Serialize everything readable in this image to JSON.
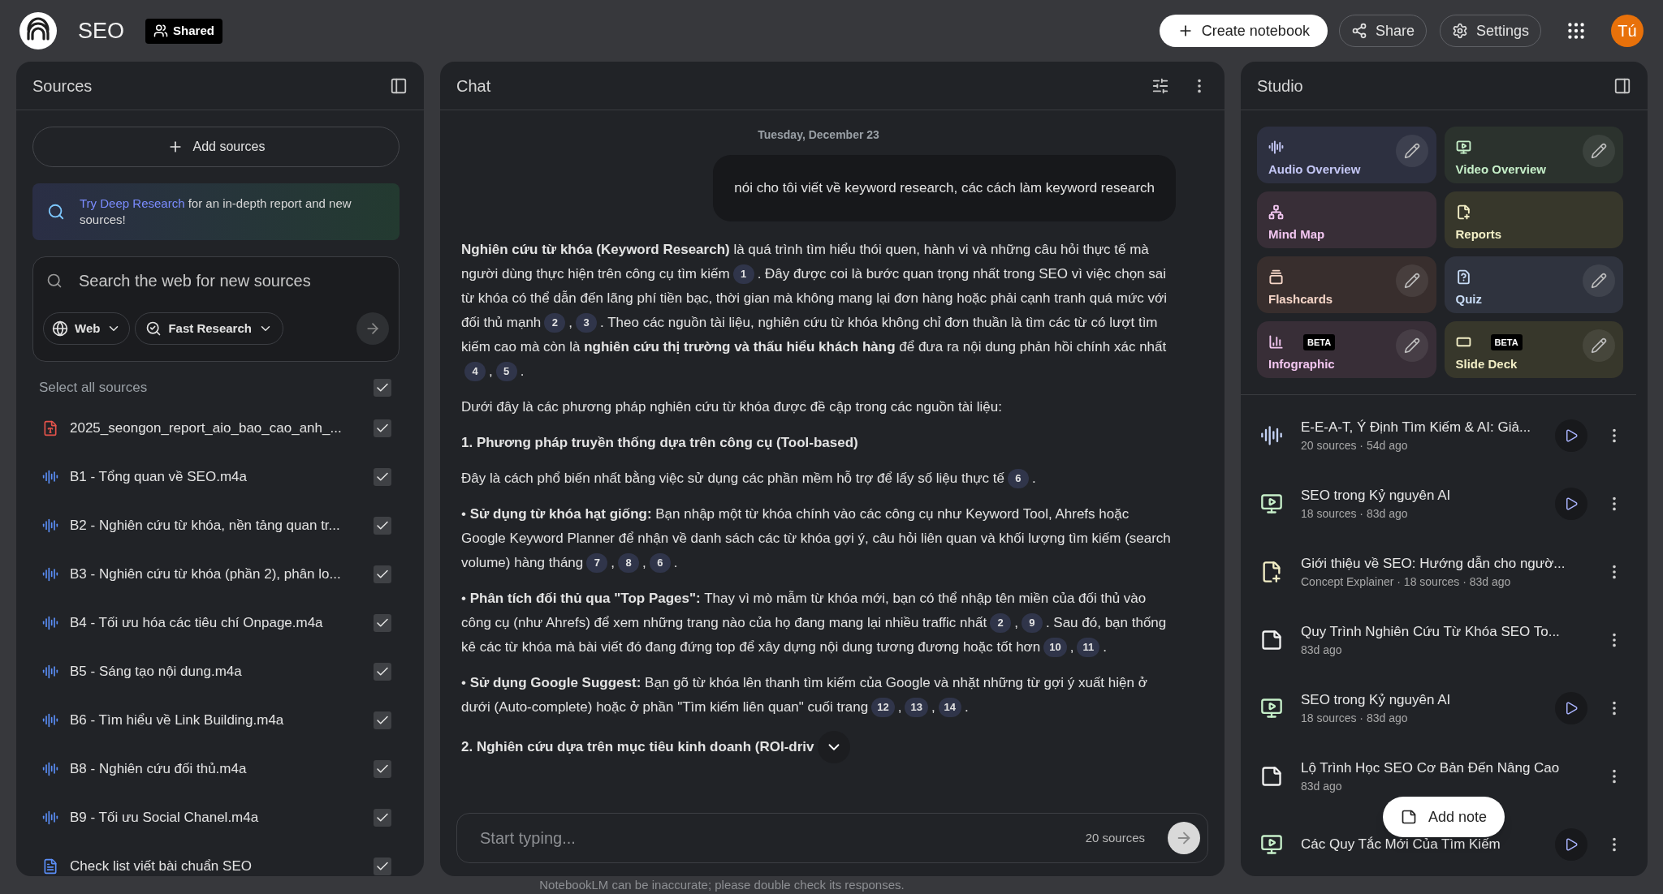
{
  "top_bar": {
    "notebook_title": "SEO",
    "shared_badge": "Shared",
    "create_button": "Create notebook",
    "share_button": "Share",
    "settings_button": "Settings",
    "avatar": "Tú"
  },
  "sources": {
    "title": "Sources",
    "add_button": "Add sources",
    "deep_research": {
      "link": "Try Deep Research",
      "text": "for an in-depth report and new sources!"
    },
    "search": {
      "placeholder": "Search the web for new sources"
    },
    "web_dropdown": "Web",
    "mode_dropdown": "Fast Research",
    "select_all": {
      "label": "Select all sources",
      "checked": true
    },
    "items": [
      {
        "kind": "pdf",
        "name": "2025_seongon_report_aio_bao_cao_anh_...",
        "checked": true
      },
      {
        "kind": "audio",
        "name": "B1 - Tổng quan về SEO.m4a",
        "checked": true
      },
      {
        "kind": "audio",
        "name": "B2 - Nghiên cứu từ khóa, nền tảng quan tr...",
        "checked": true
      },
      {
        "kind": "audio",
        "name": "B3 - Nghiên cứu từ khóa (phần 2), phân lo...",
        "checked": true
      },
      {
        "kind": "audio",
        "name": "B4 - Tối ưu hóa các tiêu chí Onpage.m4a",
        "checked": true
      },
      {
        "kind": "audio",
        "name": "B5 - Sáng tạo nội dung.m4a",
        "checked": true
      },
      {
        "kind": "audio",
        "name": "B6 - Tìm hiểu về Link Building.m4a",
        "checked": true
      },
      {
        "kind": "audio",
        "name": "B8 - Nghiên cứu đối thủ.m4a",
        "checked": true
      },
      {
        "kind": "audio",
        "name": "B9 - Tối ưu Social Chanel.m4a",
        "checked": true
      },
      {
        "kind": "doc",
        "name": "Check list viết bài chuẩn SEO",
        "checked": true
      }
    ]
  },
  "chat": {
    "title": "Chat",
    "date": "Tuesday, December 23",
    "user_message": "nói cho tôi viết về keyword research, các cách làm keyword research",
    "blocks": [
      {
        "kind": "paragraph",
        "segments": [
          {
            "kind": "text",
            "text": "**Nghiên cứu từ khóa (Keyword Research)** là quá trình tìm hiểu thói quen, hành vi và những câu hỏi thực tế mà người dùng thực hiện trên công cụ tìm kiếm"
          },
          {
            "kind": "cite",
            "text": "1"
          },
          {
            "kind": "text",
            "text": ". Đây được coi là bước quan trọng nhất trong SEO vì việc chọn sai từ khóa có thể dẫn đến lãng phí tiền bạc, thời gian mà không mang lại đơn hàng hoặc phải cạnh tranh quá mức với đối thủ mạnh"
          },
          {
            "kind": "cite",
            "text": "2"
          },
          {
            "kind": "text",
            "text": ","
          },
          {
            "kind": "cite",
            "text": "3"
          },
          {
            "kind": "text",
            "text": ". Theo các nguồn tài liệu, nghiên cứu từ khóa không chỉ đơn thuần là tìm các từ có lượt tìm kiếm cao mà còn là **nghiên cứu thị trường và thấu hiểu khách hàng** để đưa ra nội dung phản hồi chính xác nhất"
          },
          {
            "kind": "cite",
            "text": "4"
          },
          {
            "kind": "text",
            "text": ","
          },
          {
            "kind": "cite",
            "text": "5"
          },
          {
            "kind": "text",
            "text": "."
          }
        ]
      },
      {
        "kind": "paragraph",
        "segments": [
          {
            "kind": "text",
            "text": "Dưới đây là các phương pháp nghiên cứu từ khóa được đề cập trong các nguồn tài liệu:"
          }
        ]
      },
      {
        "kind": "heading",
        "segments": [
          {
            "kind": "text",
            "text": "1. Phương pháp truyền thống dựa trên công cụ (Tool-based)"
          }
        ]
      },
      {
        "kind": "paragraph",
        "segments": [
          {
            "kind": "text",
            "text": "Đây là cách phổ biến nhất bằng việc sử dụng các phần mềm hỗ trợ để lấy số liệu thực tế"
          },
          {
            "kind": "cite",
            "text": "6"
          },
          {
            "kind": "text",
            "text": "."
          }
        ]
      },
      {
        "kind": "paragraph",
        "segments": [
          {
            "kind": "text",
            "text": "• **Sử dụng từ khóa hạt giống:** Bạn nhập một từ khóa chính vào các công cụ như Keyword Tool, Ahrefs hoặc Google Keyword Planner để nhận về danh sách các từ khóa gợi ý, câu hỏi liên quan và khối lượng tìm kiếm (search volume) hàng tháng"
          },
          {
            "kind": "cite",
            "text": "7"
          },
          {
            "kind": "text",
            "text": ","
          },
          {
            "kind": "cite",
            "text": "8"
          },
          {
            "kind": "text",
            "text": ","
          },
          {
            "kind": "cite",
            "text": "6"
          },
          {
            "kind": "text",
            "text": "."
          }
        ]
      },
      {
        "kind": "paragraph",
        "segments": [
          {
            "kind": "text",
            "text": "• **Phân tích đối thủ qua \"Top Pages\":** Thay vì mò mẫm từ khóa mới, bạn có thể nhập tên miền của đối thủ vào công cụ (như Ahrefs) để xem những trang nào của họ đang mang lại nhiều traffic nhất"
          },
          {
            "kind": "cite",
            "text": "2"
          },
          {
            "kind": "text",
            "text": ","
          },
          {
            "kind": "cite",
            "text": "9"
          },
          {
            "kind": "text",
            "text": ". Sau đó, bạn thống kê các từ khóa mà bài viết đó đang đứng top để xây dựng nội dung tương đương hoặc tốt hơn"
          },
          {
            "kind": "cite",
            "text": "10"
          },
          {
            "kind": "text",
            "text": ","
          },
          {
            "kind": "cite",
            "text": "11"
          },
          {
            "kind": "text",
            "text": "."
          }
        ]
      },
      {
        "kind": "paragraph",
        "segments": [
          {
            "kind": "text",
            "text": "• **Sử dụng Google Suggest:** Bạn gõ từ khóa lên thanh tìm kiếm của Google và nhặt những từ gợi ý xuất hiện ở dưới (Auto-complete) hoặc ở phần \"Tìm kiếm liên quan\" cuối trang"
          },
          {
            "kind": "cite",
            "text": "12"
          },
          {
            "kind": "text",
            "text": ","
          },
          {
            "kind": "cite",
            "text": "13"
          },
          {
            "kind": "text",
            "text": ","
          },
          {
            "kind": "cite",
            "text": "14"
          },
          {
            "kind": "text",
            "text": "."
          }
        ]
      },
      {
        "kind": "heading",
        "segments": [
          {
            "kind": "text",
            "text": "2. Nghiên cứu dựa trên mục tiêu kinh doanh (ROI-driv"
          }
        ]
      }
    ],
    "input": {
      "placeholder": "Start typing..."
    },
    "sources_count": "20 sources"
  },
  "disclaimer": "NotebookLM can be inaccurate; please double check its responses.",
  "studio": {
    "title": "Studio",
    "tools": [
      {
        "kind": "audio",
        "label": "Audio Overview",
        "editable": true,
        "beta": false,
        "color": "#c4c7f5"
      },
      {
        "kind": "video",
        "label": "Video Overview",
        "editable": true,
        "beta": false,
        "color": "#c6efc9"
      },
      {
        "kind": "mindmap",
        "label": "Mind Map",
        "editable": false,
        "beta": false,
        "color": "#f2c6f0"
      },
      {
        "kind": "reports",
        "label": "Reports",
        "editable": false,
        "beta": false,
        "color": "#f2eec6"
      },
      {
        "kind": "flashcards",
        "label": "Flashcards",
        "editable": true,
        "beta": false,
        "color": "#f6d6c8"
      },
      {
        "kind": "quiz",
        "label": "Quiz",
        "editable": true,
        "beta": false,
        "color": "#c8dcf6"
      },
      {
        "kind": "infographic",
        "label": "Infographic",
        "editable": true,
        "beta": true,
        "beta_label": "BETA",
        "color": "#f2c6f0"
      },
      {
        "kind": "slides",
        "label": "Slide Deck",
        "editable": true,
        "beta": true,
        "beta_label": "BETA",
        "color": "#f2eec6"
      }
    ],
    "notes": [
      {
        "kind": "audio",
        "title": "E-E-A-T, Ý Định Tìm Kiếm & AI: Giả...",
        "meta": "20 sources · 54d ago",
        "playable": true
      },
      {
        "kind": "video",
        "title": "SEO trong Kỷ nguyên AI",
        "meta": "18 sources · 83d ago",
        "playable": true
      },
      {
        "kind": "report",
        "title": "Giới thiệu về SEO: Hướng dẫn cho ngườ...",
        "meta": "Concept Explainer · 18 sources · 83d ago",
        "playable": false
      },
      {
        "kind": "note",
        "title": "Quy Trình Nghiên Cứu Từ Khóa SEO To...",
        "meta": "83d ago",
        "playable": false
      },
      {
        "kind": "video",
        "title": "SEO trong Kỷ nguyên AI",
        "meta": "18 sources · 83d ago",
        "playable": true
      },
      {
        "kind": "note",
        "title": "Lộ Trình Học SEO Cơ Bản Đến Nâng Cao",
        "meta": "83d ago",
        "playable": false
      },
      {
        "kind": "video",
        "title": "Các Quy Tắc Mới Của Tìm Kiếm",
        "playable": true
      }
    ],
    "add_note": "Add note"
  }
}
